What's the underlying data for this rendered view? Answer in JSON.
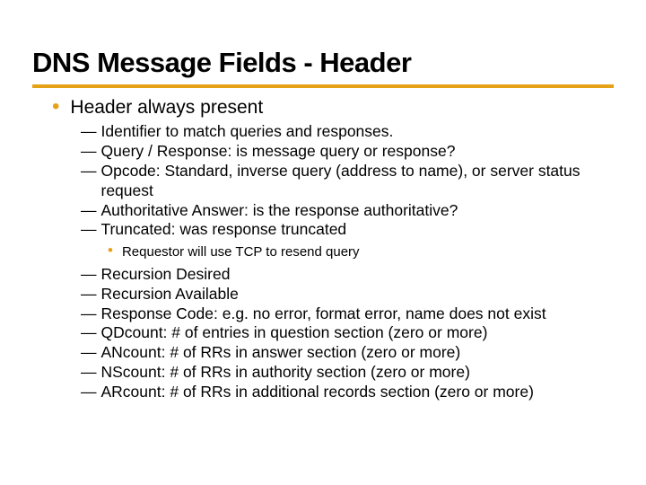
{
  "title": "DNS Message Fields - Header",
  "top": {
    "label": "Header always present"
  },
  "items1": [
    {
      "text": "Identifier to match queries and responses."
    },
    {
      "text": "Query / Response: is message query or response?"
    },
    {
      "text": "Opcode: Standard, inverse query (address to name), or server status request"
    },
    {
      "text": "Authoritative Answer: is the response authoritative?"
    },
    {
      "text": "Truncated: was response truncated"
    }
  ],
  "sub": {
    "text": "Requestor will use TCP to resend query"
  },
  "items2": [
    {
      "text": "Recursion Desired"
    },
    {
      "text": "Recursion Available"
    },
    {
      "text": "Response Code: e.g. no error, format error, name does not exist"
    },
    {
      "text": "QDcount: # of entries in question section (zero or more)"
    },
    {
      "text": "ANcount: # of RRs in answer section (zero or more)"
    },
    {
      "text": "NScount: # of RRs in authority section (zero or more)"
    },
    {
      "text": "ARcount: # of RRs in additional records section (zero or more)"
    }
  ]
}
